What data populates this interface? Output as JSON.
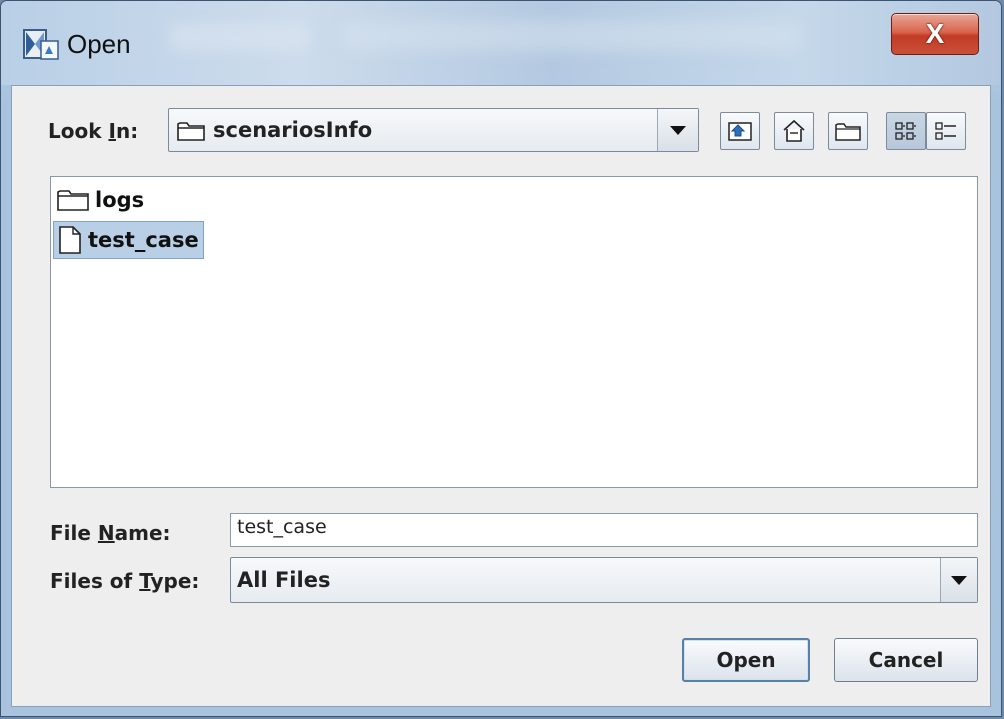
{
  "window": {
    "title": "Open"
  },
  "look_in": {
    "label_pre": "Look ",
    "label_mnemonic": "I",
    "label_post": "n:",
    "current_folder": "scenariosInfo"
  },
  "toolbar": {
    "buttons": [
      {
        "name": "up-one-level",
        "icon": "up-folder-icon"
      },
      {
        "name": "home",
        "icon": "home-icon"
      },
      {
        "name": "new-folder",
        "icon": "new-folder-icon"
      },
      {
        "name": "list-view",
        "icon": "list-view-icon",
        "pressed": true
      },
      {
        "name": "details-view",
        "icon": "details-view-icon",
        "pressed": false
      }
    ]
  },
  "files": [
    {
      "name": "logs",
      "type": "folder",
      "selected": false
    },
    {
      "name": "test_case",
      "type": "file",
      "selected": true
    }
  ],
  "file_name": {
    "label_pre": "File ",
    "label_mnemonic": "N",
    "label_post": "ame:",
    "value": "test_case"
  },
  "files_of_type": {
    "label_pre": "Files of ",
    "label_mnemonic": "T",
    "label_post": "ype:",
    "value": "All Files"
  },
  "buttons": {
    "open": "Open",
    "cancel": "Cancel"
  },
  "close_glyph": "X"
}
